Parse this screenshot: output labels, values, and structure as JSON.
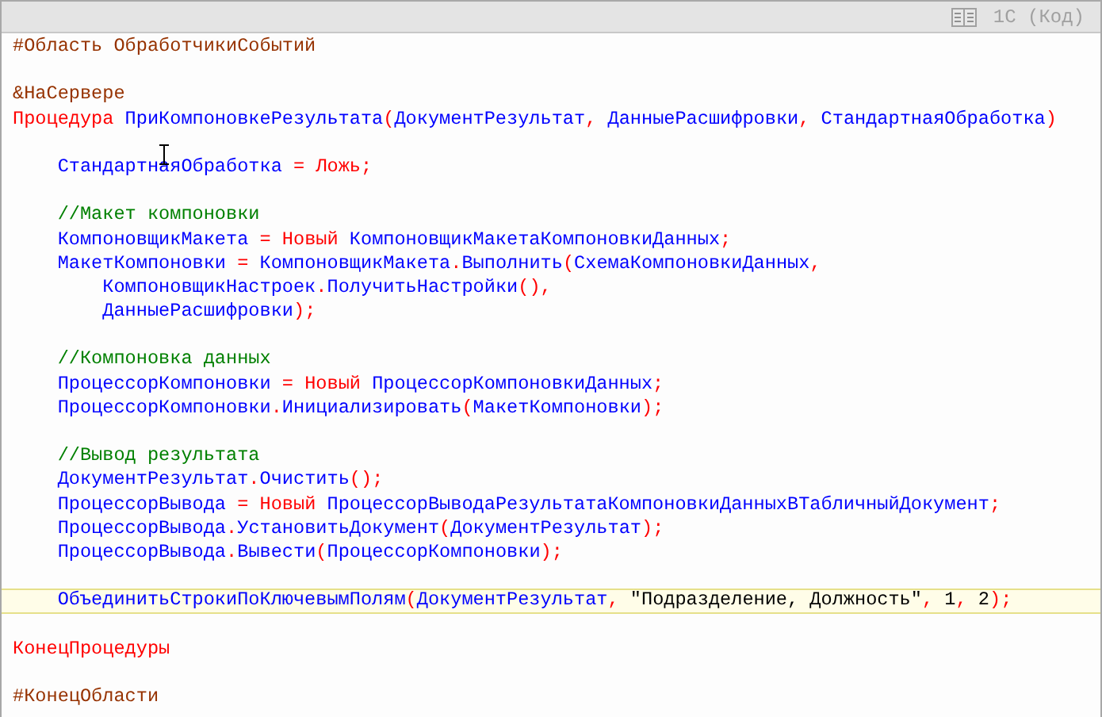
{
  "header": {
    "label": "1С (Код)"
  },
  "lines": [
    {
      "highlighted": false,
      "tokens": [
        {
          "kind": "directive",
          "text": "#Область ОбработчикиСобытий"
        }
      ]
    },
    {
      "highlighted": false
    },
    {
      "highlighted": false,
      "tokens": [
        {
          "kind": "directive",
          "text": "&НаСервере"
        }
      ]
    },
    {
      "highlighted": false,
      "tokens": [
        {
          "kind": "keyword",
          "text": "Процедура "
        },
        {
          "kind": "name",
          "text": "ПриКомпоновкеРезультата"
        },
        {
          "kind": "punct",
          "text": "("
        },
        {
          "kind": "name",
          "text": "ДокументРезультат"
        },
        {
          "kind": "punct",
          "text": ", "
        },
        {
          "kind": "name",
          "text": "ДанныеРасшифровки"
        },
        {
          "kind": "punct",
          "text": ", "
        },
        {
          "kind": "name",
          "text": "СтандартнаяОбработка"
        },
        {
          "kind": "punct",
          "text": ")"
        }
      ]
    },
    {
      "highlighted": false
    },
    {
      "highlighted": false,
      "tokens": [
        {
          "kind": "name",
          "text": "    СтандартнаяОбработка "
        },
        {
          "kind": "punct",
          "text": "= "
        },
        {
          "kind": "keyword",
          "text": "Ложь"
        },
        {
          "kind": "punct",
          "text": ";"
        }
      ]
    },
    {
      "highlighted": false
    },
    {
      "highlighted": false,
      "tokens": [
        {
          "kind": "comment",
          "text": "    //Макет компоновки"
        }
      ]
    },
    {
      "highlighted": false,
      "tokens": [
        {
          "kind": "name",
          "text": "    КомпоновщикМакета "
        },
        {
          "kind": "punct",
          "text": "= "
        },
        {
          "kind": "keyword",
          "text": "Новый "
        },
        {
          "kind": "name",
          "text": "КомпоновщикМакетаКомпоновкиДанных"
        },
        {
          "kind": "punct",
          "text": ";"
        }
      ]
    },
    {
      "highlighted": false,
      "tokens": [
        {
          "kind": "name",
          "text": "    МакетКомпоновки "
        },
        {
          "kind": "punct",
          "text": "= "
        },
        {
          "kind": "name",
          "text": "КомпоновщикМакета"
        },
        {
          "kind": "punct",
          "text": "."
        },
        {
          "kind": "name",
          "text": "Выполнить"
        },
        {
          "kind": "punct",
          "text": "("
        },
        {
          "kind": "name",
          "text": "СхемаКомпоновкиДанных"
        },
        {
          "kind": "punct",
          "text": ","
        }
      ]
    },
    {
      "highlighted": false,
      "tokens": [
        {
          "kind": "name",
          "text": "        КомпоновщикНастроек"
        },
        {
          "kind": "punct",
          "text": "."
        },
        {
          "kind": "name",
          "text": "ПолучитьНастройки"
        },
        {
          "kind": "punct",
          "text": "(),"
        }
      ]
    },
    {
      "highlighted": false,
      "tokens": [
        {
          "kind": "name",
          "text": "        ДанныеРасшифровки"
        },
        {
          "kind": "punct",
          "text": ");"
        }
      ]
    },
    {
      "highlighted": false
    },
    {
      "highlighted": false,
      "tokens": [
        {
          "kind": "comment",
          "text": "    //Компоновка данных"
        }
      ]
    },
    {
      "highlighted": false,
      "tokens": [
        {
          "kind": "name",
          "text": "    ПроцессорКомпоновки "
        },
        {
          "kind": "punct",
          "text": "= "
        },
        {
          "kind": "keyword",
          "text": "Новый "
        },
        {
          "kind": "name",
          "text": "ПроцессорКомпоновкиДанных"
        },
        {
          "kind": "punct",
          "text": ";"
        }
      ]
    },
    {
      "highlighted": false,
      "tokens": [
        {
          "kind": "name",
          "text": "    ПроцессорКомпоновки"
        },
        {
          "kind": "punct",
          "text": "."
        },
        {
          "kind": "name",
          "text": "Инициализировать"
        },
        {
          "kind": "punct",
          "text": "("
        },
        {
          "kind": "name",
          "text": "МакетКомпоновки"
        },
        {
          "kind": "punct",
          "text": ");"
        }
      ]
    },
    {
      "highlighted": false
    },
    {
      "highlighted": false,
      "tokens": [
        {
          "kind": "comment",
          "text": "    //Вывод результата"
        }
      ]
    },
    {
      "highlighted": false,
      "tokens": [
        {
          "kind": "name",
          "text": "    ДокументРезультат"
        },
        {
          "kind": "punct",
          "text": "."
        },
        {
          "kind": "name",
          "text": "Очистить"
        },
        {
          "kind": "punct",
          "text": "();"
        }
      ]
    },
    {
      "highlighted": false,
      "tokens": [
        {
          "kind": "name",
          "text": "    ПроцессорВывода "
        },
        {
          "kind": "punct",
          "text": "= "
        },
        {
          "kind": "keyword",
          "text": "Новый "
        },
        {
          "kind": "name",
          "text": "ПроцессорВыводаРезультатаКомпоновкиДанныхВТабличныйДокумент"
        },
        {
          "kind": "punct",
          "text": ";"
        }
      ]
    },
    {
      "highlighted": false,
      "tokens": [
        {
          "kind": "name",
          "text": "    ПроцессорВывода"
        },
        {
          "kind": "punct",
          "text": "."
        },
        {
          "kind": "name",
          "text": "УстановитьДокумент"
        },
        {
          "kind": "punct",
          "text": "("
        },
        {
          "kind": "name",
          "text": "ДокументРезультат"
        },
        {
          "kind": "punct",
          "text": ");"
        }
      ]
    },
    {
      "highlighted": false,
      "tokens": [
        {
          "kind": "name",
          "text": "    ПроцессорВывода"
        },
        {
          "kind": "punct",
          "text": "."
        },
        {
          "kind": "name",
          "text": "Вывести"
        },
        {
          "kind": "punct",
          "text": "("
        },
        {
          "kind": "name",
          "text": "ПроцессорКомпоновки"
        },
        {
          "kind": "punct",
          "text": ");"
        }
      ]
    },
    {
      "highlighted": false
    },
    {
      "highlighted": true,
      "tokens": [
        {
          "kind": "name",
          "text": "    ОбъединитьСтрокиПоКлючевымПолям"
        },
        {
          "kind": "punct",
          "text": "("
        },
        {
          "kind": "name",
          "text": "ДокументРезультат"
        },
        {
          "kind": "punct",
          "text": ", "
        },
        {
          "kind": "string",
          "text": "\"Подразделение, Должность\""
        },
        {
          "kind": "punct",
          "text": ", "
        },
        {
          "kind": "number",
          "text": "1"
        },
        {
          "kind": "punct",
          "text": ", "
        },
        {
          "kind": "number",
          "text": "2"
        },
        {
          "kind": "punct",
          "text": ");"
        }
      ]
    },
    {
      "highlighted": false
    },
    {
      "highlighted": false,
      "tokens": [
        {
          "kind": "keyword",
          "text": "КонецПроцедуры"
        }
      ]
    },
    {
      "highlighted": false
    },
    {
      "highlighted": false,
      "tokens": [
        {
          "kind": "directive",
          "text": "#КонецОбласти"
        }
      ]
    }
  ]
}
